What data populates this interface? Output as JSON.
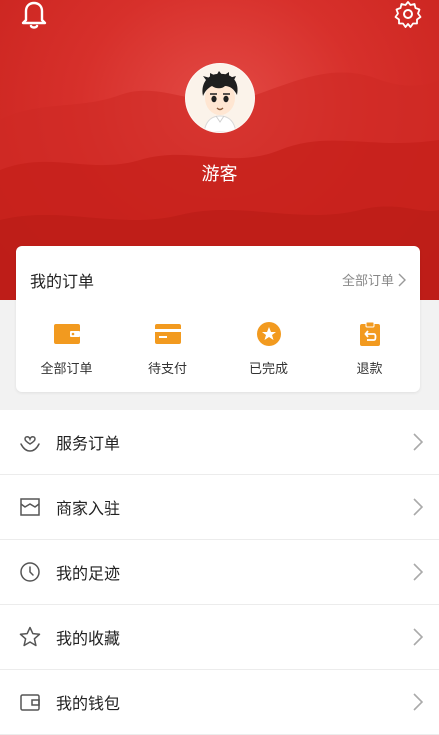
{
  "user": {
    "name": "游客"
  },
  "orders": {
    "title": "我的订单",
    "more_label": "全部订单",
    "items": [
      {
        "label": "全部订单",
        "icon": "wallet-icon"
      },
      {
        "label": "待支付",
        "icon": "card-icon"
      },
      {
        "label": "已完成",
        "icon": "completed-badge-icon"
      },
      {
        "label": "退款",
        "icon": "refund-icon"
      }
    ]
  },
  "menu": [
    {
      "label": "服务订单",
      "icon": "heart-hand-icon"
    },
    {
      "label": "商家入驻",
      "icon": "store-icon"
    },
    {
      "label": "我的足迹",
      "icon": "clock-icon"
    },
    {
      "label": "我的收藏",
      "icon": "star-icon"
    },
    {
      "label": "我的钱包",
      "icon": "wallet-outline-icon"
    }
  ],
  "colors": {
    "brand_red": "#d7302b",
    "icon_orange": "#f29a1f"
  }
}
